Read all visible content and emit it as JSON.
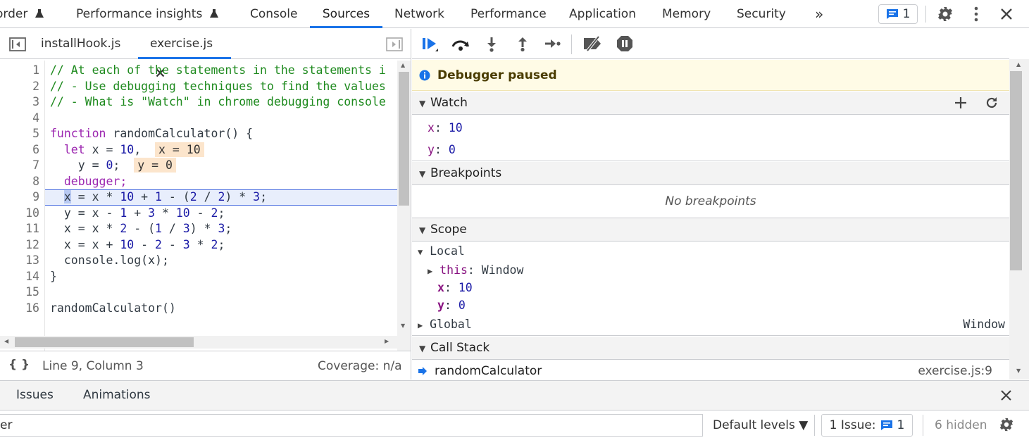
{
  "colors": {
    "accent": "#1a73e8",
    "paused_bg": "#fffbe6",
    "comment": "#1e8a1e",
    "keyword": "#9c27b0",
    "number": "#1a1aa6",
    "inline_value_bg": "#fce5cc"
  },
  "topbar": {
    "tabs": [
      "order",
      "Performance insights",
      "Console",
      "Sources",
      "Network",
      "Performance",
      "Application",
      "Memory",
      "Security"
    ],
    "active_tab": "Sources",
    "more_label": "»",
    "issues_count": "1"
  },
  "editor": {
    "file_tabs": [
      "installHook.js",
      "exercise.js"
    ],
    "active_file": "exercise.js",
    "lines": [
      {
        "n": "1",
        "text": "// At each of the statements in the statements i"
      },
      {
        "n": "2",
        "text": "// - Use debugging techniques to find the values"
      },
      {
        "n": "3",
        "text": "// - What is \"Watch\" in chrome debugging console"
      },
      {
        "n": "4",
        "text": ""
      },
      {
        "n": "5",
        "text": "function randomCalculator() {"
      },
      {
        "n": "6",
        "text": "  let x = 10,",
        "inline": "x = 10"
      },
      {
        "n": "7",
        "text": "    y = 0;",
        "inline": "y = 0"
      },
      {
        "n": "8",
        "text": "  debugger;"
      },
      {
        "n": "9",
        "text": "  x = x * 10 + 1 - (2 / 2) * 3;"
      },
      {
        "n": "10",
        "text": "  y = x - 1 + 3 * 10 - 2;"
      },
      {
        "n": "11",
        "text": "  x = x * 2 - (1 / 3) * 3;"
      },
      {
        "n": "12",
        "text": "  x = x + 10 - 2 - 3 * 2;"
      },
      {
        "n": "13",
        "text": "  console.log(x);"
      },
      {
        "n": "14",
        "text": "}"
      },
      {
        "n": "15",
        "text": ""
      },
      {
        "n": "16",
        "text": "randomCalculator()"
      }
    ],
    "status": {
      "pretty_print": "{ }",
      "position": "Line 9, Column 3",
      "coverage": "Coverage: n/a"
    }
  },
  "debugger": {
    "paused_label": "Debugger paused",
    "watch": {
      "title": "Watch",
      "items": [
        {
          "name": "x",
          "value": "10"
        },
        {
          "name": "y",
          "value": "0"
        }
      ]
    },
    "breakpoints": {
      "title": "Breakpoints",
      "empty": "No breakpoints"
    },
    "scope": {
      "title": "Scope",
      "local_label": "Local",
      "this_label": "this",
      "this_value": "Window",
      "vars": [
        {
          "name": "x",
          "value": "10"
        },
        {
          "name": "y",
          "value": "0"
        }
      ],
      "global_label": "Global",
      "global_value": "Window"
    },
    "call_stack": {
      "title": "Call Stack",
      "frame": "randomCalculator",
      "location": "exercise.js:9"
    }
  },
  "drawer": {
    "tabs": [
      "Issues",
      "Animations"
    ],
    "filter_placeholder": "er",
    "levels": "Default levels ▼",
    "issues_label": "1 Issue:",
    "issues_count": "1",
    "hidden": "6 hidden"
  }
}
